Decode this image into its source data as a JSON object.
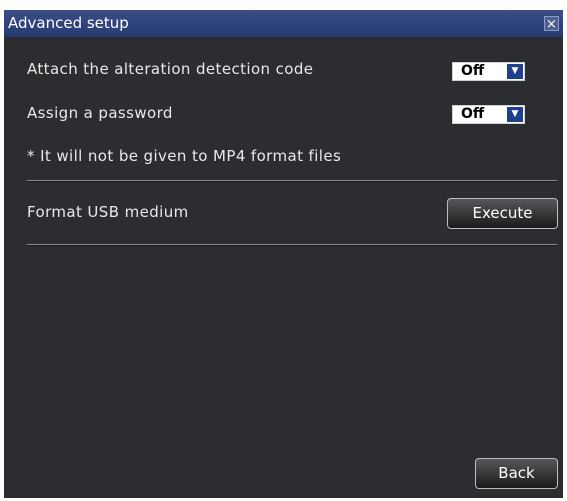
{
  "dialog": {
    "title": "Advanced setup",
    "close_glyph": "×"
  },
  "settings": {
    "alteration": {
      "label": "Attach the alteration detection code",
      "value": "Off",
      "arrow": "▼"
    },
    "password": {
      "label": "Assign a password",
      "value": "Off",
      "arrow": "▼"
    },
    "note": "* It will not be given to MP4 format files",
    "format": {
      "label": "Format USB medium",
      "button": "Execute"
    }
  },
  "footer": {
    "back_label": "Back"
  },
  "icons": {
    "close": "close-icon",
    "dropdown": "chevron-down-icon"
  },
  "colors": {
    "title_bar": "#2b3f78",
    "panel_bg": "#2c2d30",
    "dropdown_arrow": "#1f3e8c"
  }
}
